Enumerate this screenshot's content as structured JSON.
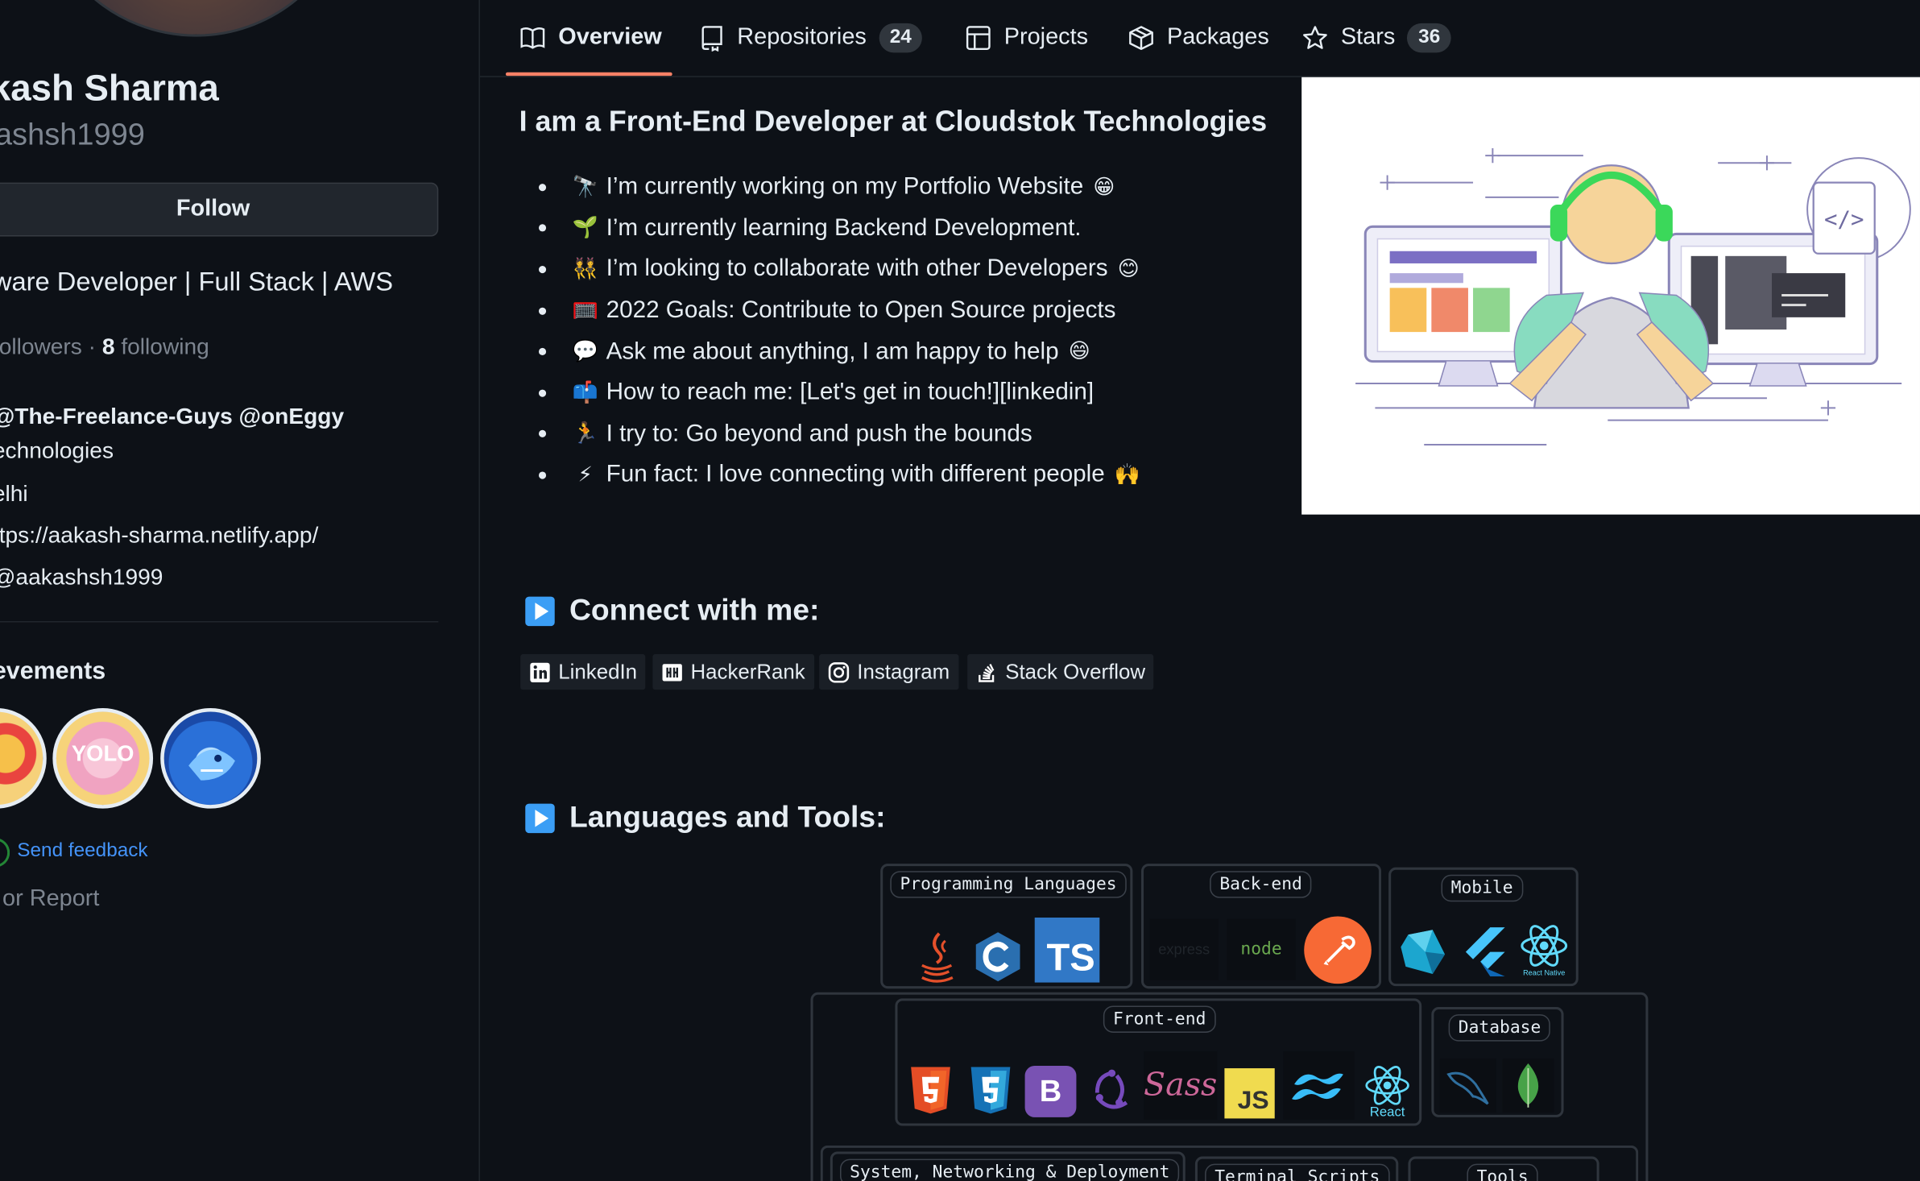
{
  "profile": {
    "name": "kash Sharma",
    "login": "ashsh1999",
    "follow_label": "Follow",
    "bio": "ware Developer | Full Stack | AWS",
    "followers_label": " followers · ",
    "following_count": "8",
    "following_label": " following",
    "orgs": "@The-Freelance-Guys @onEggy",
    "company": "echnologies",
    "location": "elhi",
    "website": "ttps://aakash-sharma.netlify.app/",
    "twitter": "@aakashsh1999",
    "achievements_title": "evements",
    "badge_yolo": "YOLO",
    "feedback_label": "Send feedback",
    "report_label": "or Report"
  },
  "tabs": [
    {
      "label": "Overview",
      "icon": "book-icon",
      "active": true
    },
    {
      "label": "Repositories",
      "icon": "repo-icon",
      "count": "24"
    },
    {
      "label": "Projects",
      "icon": "table-icon"
    },
    {
      "label": "Packages",
      "icon": "package-icon"
    },
    {
      "label": "Stars",
      "icon": "star-icon",
      "count": "36"
    }
  ],
  "readme": {
    "heading": "I am a Front-End Developer at Cloudstok Technologies",
    "bullets": [
      {
        "emoji": "🔭",
        "text": "I’m currently working on my Portfolio Website",
        "end": "😁"
      },
      {
        "emoji": "🌱",
        "text": "I’m currently learning Backend Development.",
        "end": ""
      },
      {
        "emoji": "👯",
        "text": "I’m looking to collaborate with other Developers",
        "end": "😊"
      },
      {
        "emoji": "🥅",
        "text": "2022 Goals: Contribute to Open Source projects",
        "end": ""
      },
      {
        "emoji": "💬",
        "text": "Ask me about anything, I am happy to help",
        "end": "😄"
      },
      {
        "emoji": "📫",
        "text": "How to reach me: [Let's get in touch!][linkedin]",
        "end": ""
      },
      {
        "emoji": "🏃",
        "text": "I try to: Go beyond and push the bounds",
        "end": ""
      },
      {
        "emoji": "⚡",
        "text": "Fun fact: I love connecting with different people",
        "end": "🙌"
      }
    ],
    "illustration_code_tag": "</>",
    "connect_heading": "Connect with me:",
    "social": [
      {
        "label": "LinkedIn",
        "icon": "linkedin-icon"
      },
      {
        "label": "HackerRank",
        "icon": "hackerrank-icon"
      },
      {
        "label": "Instagram",
        "icon": "instagram-icon"
      },
      {
        "label": "Stack Overflow",
        "icon": "stackoverflow-icon"
      }
    ],
    "tools_heading": "Languages and Tools:",
    "tool_groups": {
      "programming": {
        "label": "Programming Languages",
        "tools": [
          "java-icon",
          "c-icon",
          "typescript-icon"
        ],
        "ts_text": "TS"
      },
      "backend": {
        "label": "Back-end",
        "tools": [
          "express-icon",
          "nodejs-icon",
          "postman-icon"
        ],
        "express_text": "express",
        "node_text": "node"
      },
      "mobile": {
        "label": "Mobile",
        "tools": [
          "dart-icon",
          "flutter-icon",
          "react-native-icon"
        ],
        "rn_text": "React Native"
      },
      "frontend": {
        "label": "Front-end",
        "tools": [
          "html5-icon",
          "css3-icon",
          "bootstrap-icon",
          "redux-icon",
          "sass-icon",
          "javascript-icon",
          "tailwind-icon",
          "react-icon"
        ],
        "bootstrap_text": "B",
        "sass_text": "Sass",
        "js_text": "JS",
        "react_text": "React"
      },
      "database": {
        "label": "Database",
        "tools": [
          "mysql-icon",
          "mongodb-icon"
        ]
      },
      "system": {
        "label": "System, Networking & Deployment"
      },
      "terminal": {
        "label": "Terminal Scripts"
      },
      "tools": {
        "label": "Tools"
      }
    }
  },
  "colors": {
    "bg": "#0d1117",
    "text": "#e6edf3",
    "muted": "#7d8590",
    "link": "#4493f8",
    "tab_underline": "#f78166",
    "counter_bg": "#30363d",
    "play_blue": "#3b9ef5"
  }
}
